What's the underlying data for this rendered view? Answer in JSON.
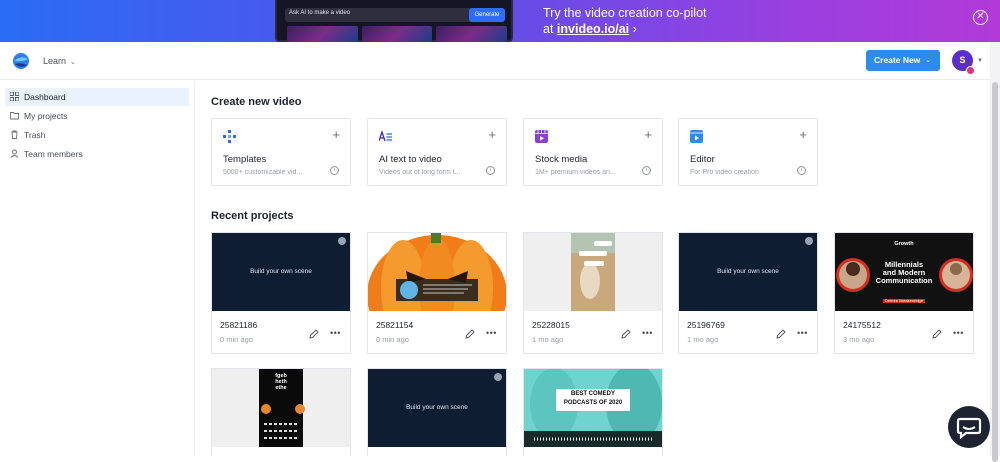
{
  "banner": {
    "input_placeholder": "Ask AI to make a video",
    "generate_label": "Generate",
    "headline": "Try the video creation co-pilot",
    "at": "at",
    "link": "invideo.io/ai",
    "arrow": "›"
  },
  "topbar": {
    "learn_label": "Learn",
    "create_label": "Create New",
    "avatar_initial": "S"
  },
  "sidebar": {
    "items": [
      {
        "label": "Dashboard",
        "icon": "grid-icon"
      },
      {
        "label": "My projects",
        "icon": "folder-icon"
      },
      {
        "label": "Trash",
        "icon": "trash-icon"
      },
      {
        "label": "Team members",
        "icon": "team-icon"
      }
    ]
  },
  "main": {
    "create_heading": "Create new video",
    "recent_heading": "Recent projects",
    "cards": [
      {
        "title": "Templates",
        "subtitle": "5000+ customizable vid...",
        "icon": "templates-icon"
      },
      {
        "title": "AI text to video",
        "subtitle": "Videos out of long form t...",
        "icon": "ai-text-icon"
      },
      {
        "title": "Stock media",
        "subtitle": "1M+ premium videos an...",
        "icon": "stock-media-icon"
      },
      {
        "title": "Editor",
        "subtitle": "For Pro video creation",
        "icon": "editor-icon"
      }
    ],
    "scene_text": "Build your own scene",
    "projects": [
      {
        "name": "25821186",
        "date": "0 min ago"
      },
      {
        "name": "25821154",
        "date": "0 min ago"
      },
      {
        "name": "25228015",
        "date": "1 mo ago"
      },
      {
        "name": "25196769",
        "date": "1 mo ago"
      },
      {
        "name": "24175512",
        "date": "3 mo ago"
      }
    ],
    "thumb_text": {
      "growth": "Growth",
      "millennials_1": "Millennials",
      "millennials_2": "and Modern",
      "millennials_3": "Communication",
      "presenter": "Deirdre Breakenridge",
      "fgeb": "fgeb\nheth\nethe",
      "podcast_1": "BEST COMEDY",
      "podcast_2": "PODCASTS OF 2020"
    }
  },
  "colors": {
    "primary": "#2d8ceb",
    "sidebar_active": "#e9f2fd",
    "avatar": "#5b2ec7",
    "scene_bg": "#0f1d33"
  }
}
